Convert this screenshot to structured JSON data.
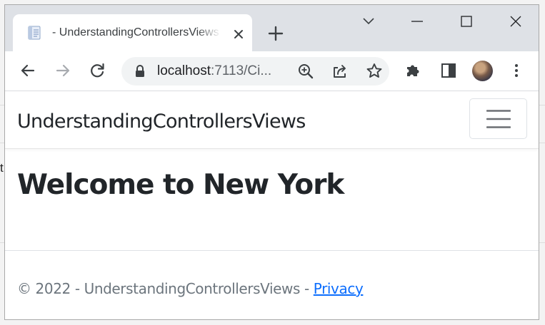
{
  "browser": {
    "tab_title": "- UnderstandingControllersViews",
    "url_host": "localhost",
    "url_rest": ":7113/Ci..."
  },
  "site": {
    "brand": "UnderstandingControllersViews",
    "heading": "Welcome to New York",
    "footer_text": "© 2022 - UnderstandingControllersViews - ",
    "footer_link": "Privacy"
  },
  "background": {
    "stray_text": "t"
  },
  "icons": {
    "tab_favicon": "page-icon",
    "tab_close": "close-icon",
    "new_tab": "plus-icon",
    "tab_search": "chevron-down-icon",
    "minimize": "minimize-icon",
    "maximize": "maximize-icon",
    "close_window": "close-icon",
    "back": "back-arrow-icon",
    "forward": "forward-arrow-icon",
    "reload": "reload-icon",
    "lock": "lock-icon",
    "zoom": "zoom-icon",
    "share": "share-icon",
    "bookmark": "star-icon",
    "extensions": "puzzle-icon",
    "side_panel": "side-panel-icon",
    "menu": "kebab-menu-icon",
    "navbar_toggler": "hamburger-icon"
  },
  "colors": {
    "link": "#0d6efd",
    "text": "#212529",
    "muted": "#6c757d",
    "tabstrip": "#dee1e6"
  }
}
